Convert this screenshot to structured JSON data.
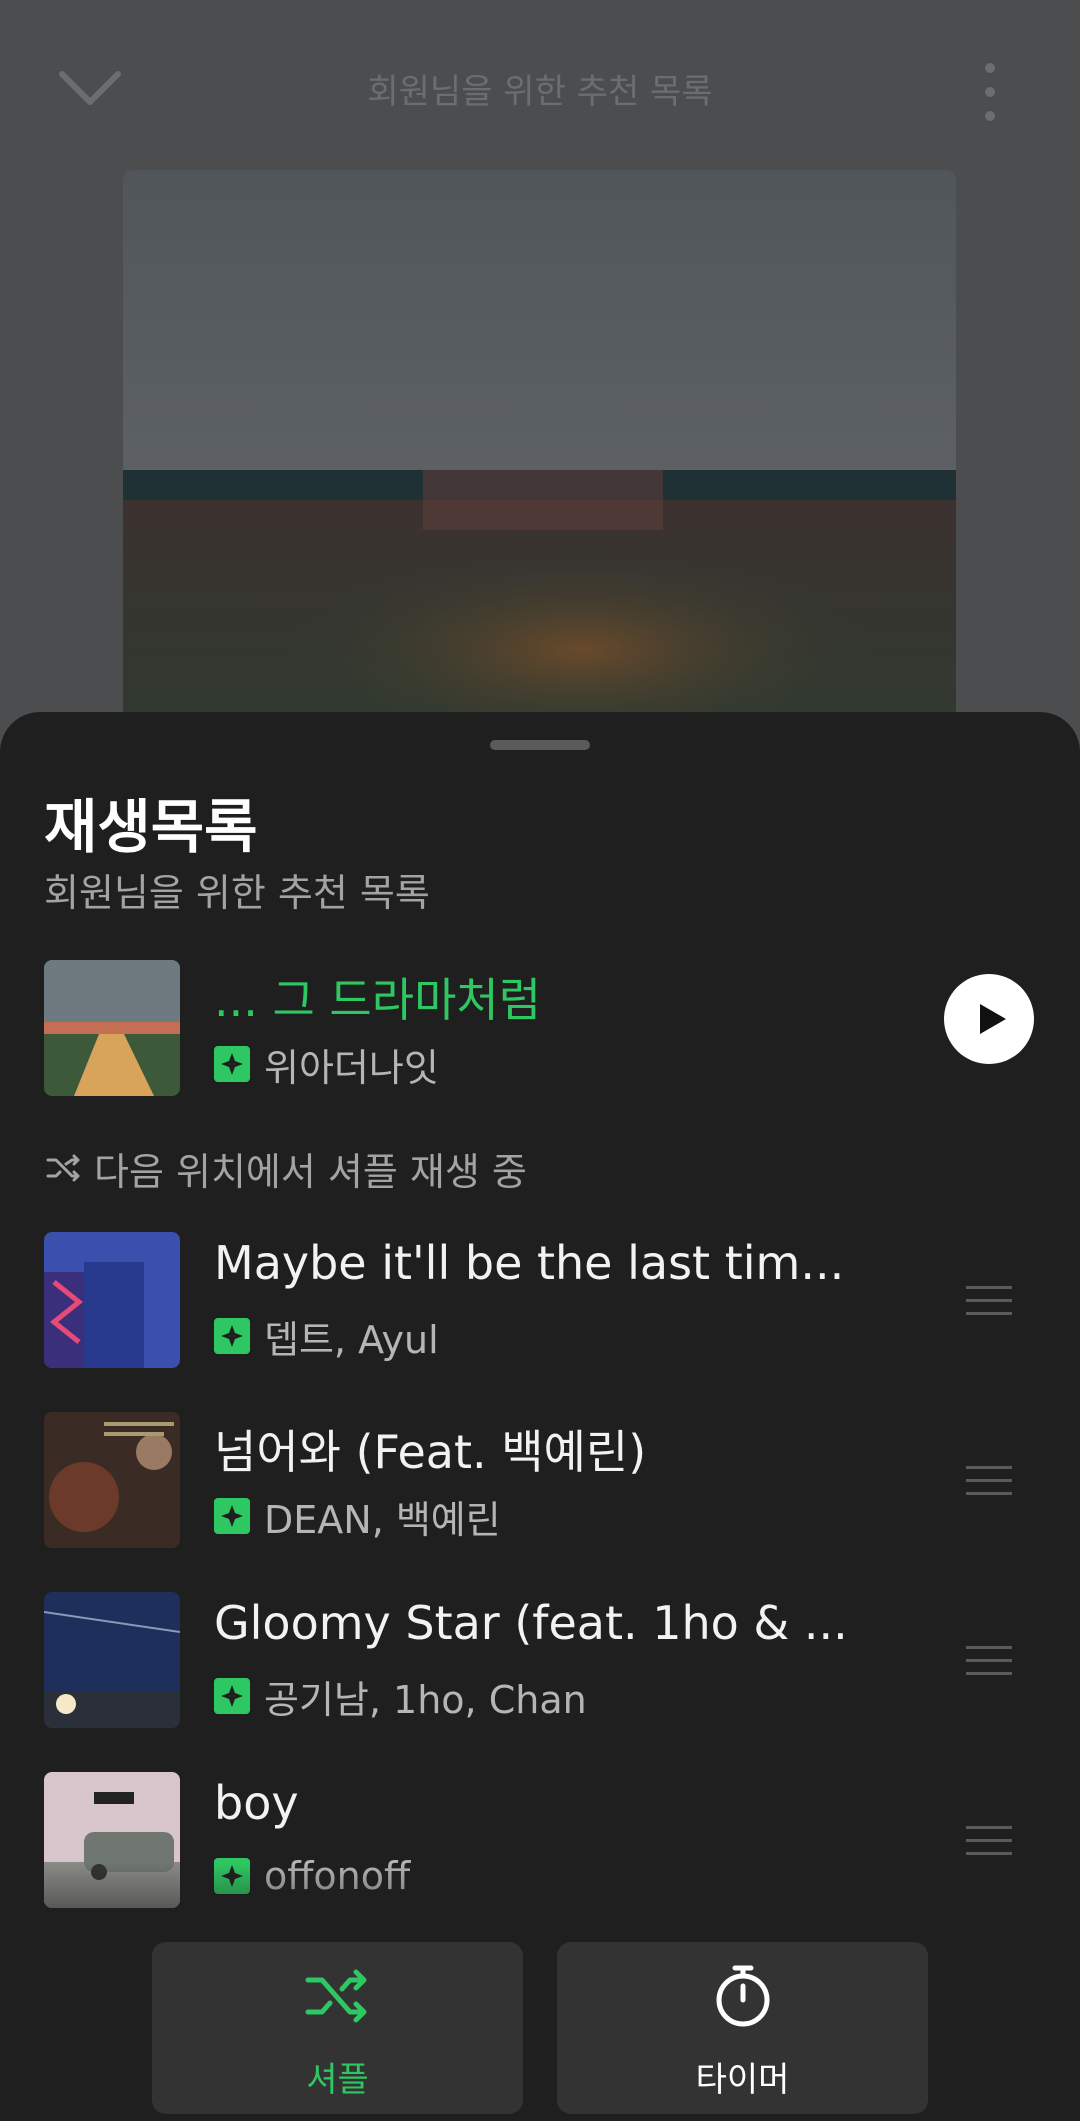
{
  "player": {
    "title": "회원님을 위한 추천 목록"
  },
  "sheet": {
    "title": "재생목록",
    "subtitle": "회원님을 위한 추천 목록"
  },
  "now_playing": {
    "title": "... 그 드라마처럼",
    "artist": "위아더나잇"
  },
  "shuffle_notice": "다음 위치에서 셔플 재생 중",
  "queue": [
    {
      "title": "Maybe it'll be the last tim...",
      "artist": "뎁트, Ayul"
    },
    {
      "title": "넘어와 (Feat. 백예린)",
      "artist": "DEAN, 백예린"
    },
    {
      "title": "Gloomy Star (feat. 1ho & ...",
      "artist": "공기남, 1ho, Chan"
    },
    {
      "title": "boy",
      "artist": "offonoff"
    }
  ],
  "controls": {
    "shuffle_label": "셔플",
    "timer_label": "타이머"
  },
  "colors": {
    "accent": "#2ec862",
    "background": "#1f1f1f"
  }
}
